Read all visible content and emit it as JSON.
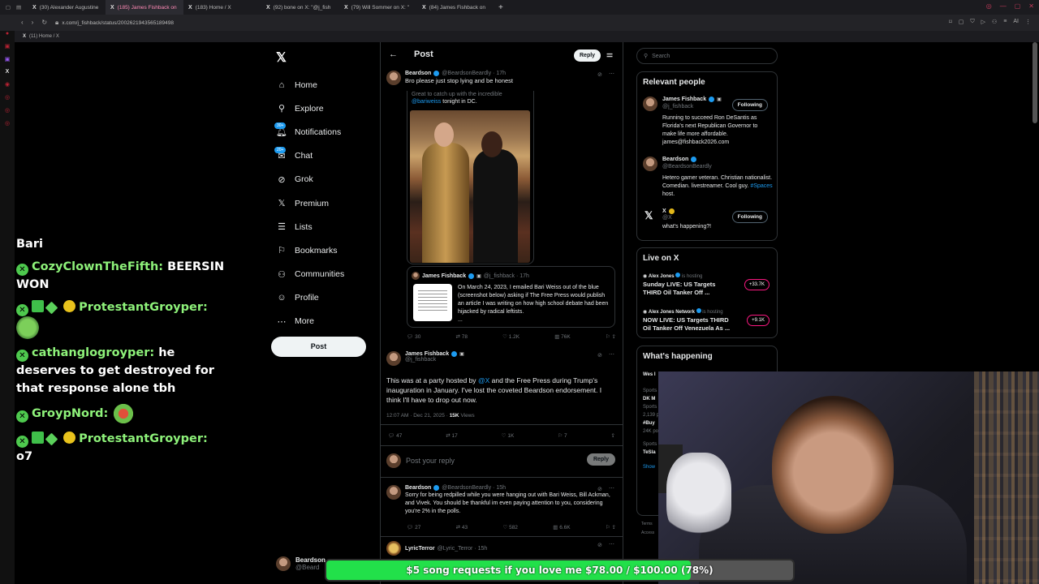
{
  "browser": {
    "tabs": [
      {
        "title": "(30) Alexander Augustine",
        "active": false
      },
      {
        "title": "(185) James Fishback on",
        "active": true
      },
      {
        "title": "(183) Home / X",
        "active": false
      },
      {
        "title": "(92) bone on X: \"@j_fish",
        "active": false
      },
      {
        "title": "(79) Will Sommer on X: \"",
        "active": false
      },
      {
        "title": "(84) James Fishback on",
        "active": false
      }
    ],
    "new_tab": "+",
    "url": "x.com/j_fishback/status/2002621943565189498",
    "bookmark": "(11) Home / X",
    "ai_label": "AI"
  },
  "chat": [
    {
      "name": "",
      "text": "Bari"
    },
    {
      "name": "CozyClownTheFifth:",
      "text": "BEERSIN WON"
    },
    {
      "name": "ProtestantGroyper:",
      "text": ""
    },
    {
      "name": "cathanglogroyper:",
      "text": "he deserves to get destroyed for that response alone tbh"
    },
    {
      "name": "GroypNord:",
      "text": ""
    },
    {
      "name": "ProtestantGroyper:",
      "text": "o7"
    }
  ],
  "nav": {
    "items": [
      {
        "label": "Home",
        "icon": "home-icon"
      },
      {
        "label": "Explore",
        "icon": "search-icon"
      },
      {
        "label": "Notifications",
        "icon": "bell-icon",
        "badge": "30+"
      },
      {
        "label": "Chat",
        "icon": "mail-icon",
        "badge": "20+"
      },
      {
        "label": "Grok",
        "icon": "grok-icon"
      },
      {
        "label": "Premium",
        "icon": "x-icon"
      },
      {
        "label": "Lists",
        "icon": "list-icon"
      },
      {
        "label": "Bookmarks",
        "icon": "bookmark-icon"
      },
      {
        "label": "Communities",
        "icon": "people-icon"
      },
      {
        "label": "Profile",
        "icon": "person-icon"
      },
      {
        "label": "More",
        "icon": "more-icon"
      }
    ],
    "post_label": "Post",
    "account_name": "Beardson",
    "account_handle": "@Beard"
  },
  "main": {
    "header_title": "Post",
    "reply_label": "Reply",
    "tweet1": {
      "name": "Beardson",
      "handle": "@BeardsonBeardly · 17h",
      "text": "Bro please just stop lying and be honest",
      "quote_text_pre": "Great to catch up with the incredible",
      "quote_mention": "@bariweiss",
      "quote_text_post": "tonight in DC.",
      "quote2_name": "James Fishback",
      "quote2_handle": "@j_fishback · 17h",
      "quote2_text": "On March 24, 2023, I emailed Bari Weiss out of the blue (screenshot below) asking if The Free Press would publish an article I was writing on how high school debate had been hijacked by radical leftists.",
      "quote2_more": "...",
      "replies": "30",
      "reposts": "78",
      "likes": "1.2K",
      "views": "76K"
    },
    "tweet2": {
      "name": "James Fishback",
      "handle": "@j_fishback",
      "text_pre": "This was at a party hosted by",
      "mention": "@X",
      "text_post": "and the Free Press during Trump's inauguration in January. I've lost the coveted Beardson endorsement. I think I'll have to drop out now.",
      "time": "12:07 AM · Dec 21, 2025 · ",
      "views_count": "15K",
      "views_label": "Views",
      "replies": "47",
      "reposts": "17",
      "likes": "1K",
      "bookmarks": "7"
    },
    "reply_placeholder": "Post your reply",
    "reply_button": "Reply",
    "tweet3": {
      "name": "Beardson",
      "handle": "@BeardsonBeardly · 15h",
      "text": "Sorry for being redpilled while you were hanging out with Bari Weiss, Bill Ackman, and Vivek. You should be thankful im even paying attention to you, considering you're 2% in the polls.",
      "replies": "27",
      "reposts": "43",
      "likes": "582",
      "views": "6.6K"
    },
    "tweet4": {
      "name": "LyricTerror",
      "handle": "@Lyric_Terror · 15h"
    }
  },
  "right": {
    "search_placeholder": "Search",
    "relevant_title": "Relevant people",
    "people": [
      {
        "name": "James Fishback",
        "handle": "@j_fishback",
        "button": "Following",
        "bio": "Running to succeed Ron DeSantis as Florida's next Republican Governor to make life more affordable. james@fishback2026.com"
      },
      {
        "name": "Beardson",
        "handle": "@BeardsonBeardly",
        "button": "",
        "bio_pre": "Hetero gamer veteran. Christian nationalist. Comedian. livestreamer. Cool guy.",
        "bio_tag": "#Spaces",
        "bio_post": "host."
      },
      {
        "name": "X",
        "handle": "@X",
        "button": "Following",
        "bio": "what's happening?!"
      }
    ],
    "live_title": "Live on X",
    "live": [
      {
        "host": "Alex Jones",
        "status": "is hosting",
        "title": "Sunday LIVE: US Targets THIRD Oil Tanker Off ...",
        "count": "+33.7K"
      },
      {
        "host": "Alex Jones Network",
        "status": "is hosting",
        "title": "NOW LIVE: US Targets THIRD Oil Tanker Off Venezuela As ...",
        "count": "+9.1K"
      }
    ],
    "happening_title": "What's happening",
    "happening_partial": [
      "Wes I",
      "Sports",
      "DK M",
      "Sports",
      "2,139 p",
      "#Buy",
      "24K po",
      "Sports",
      "TeSla",
      "Show"
    ],
    "footer_partial": [
      "Terms",
      "Access"
    ]
  },
  "donation": {
    "label": "$5 song requests if you love me $78.00 / $100.00 (78%)",
    "progress": 0.78,
    "color": "#22e04a"
  }
}
